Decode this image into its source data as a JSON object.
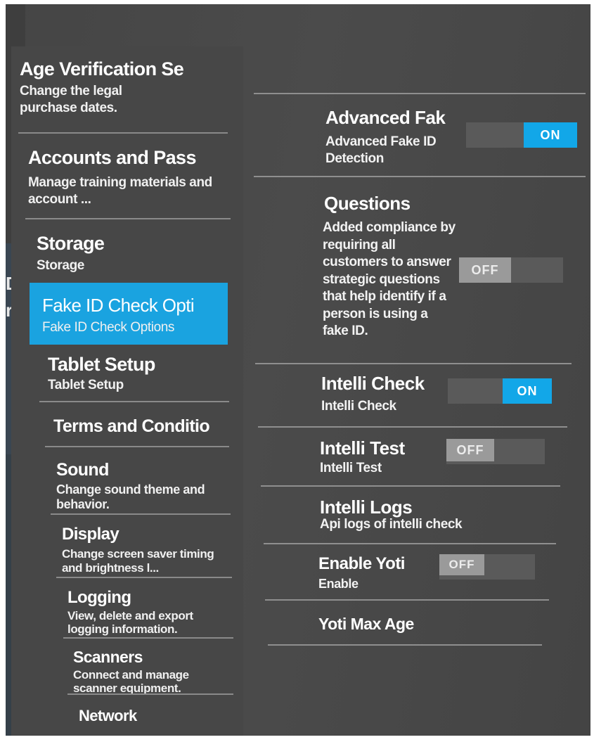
{
  "background_app": {
    "letters": [
      "D",
      "re"
    ]
  },
  "sidebar": {
    "active_color": "#1aa3e0",
    "items": [
      {
        "title": "Age Verification Se",
        "subtitle": "Change the legal purchase dates."
      },
      {
        "title": "Accounts and Pass",
        "subtitle": "Manage training materials and account ..."
      },
      {
        "title": "Storage",
        "subtitle": "Storage"
      },
      {
        "title": "Fake ID Check Opti",
        "subtitle": "Fake ID Check Options",
        "active": true
      },
      {
        "title": "Tablet Setup",
        "subtitle": "Tablet Setup"
      },
      {
        "title": "Terms and Conditio",
        "subtitle": ""
      },
      {
        "title": "Sound",
        "subtitle": "Change sound theme and behavior."
      },
      {
        "title": "Display",
        "subtitle": "Change screen saver timing and brightness l..."
      },
      {
        "title": "Logging",
        "subtitle": "View, delete and export logging information."
      },
      {
        "title": "Scanners",
        "subtitle": "Connect and manage scanner equipment."
      },
      {
        "title": "Network",
        "subtitle": ""
      }
    ]
  },
  "settings": {
    "on_color": "#12a7e8",
    "off_color": "#9a9a9a",
    "items": [
      {
        "title": "Advanced Fak",
        "subtitle": "Advanced Fake ID Detection",
        "toggle": "ON"
      },
      {
        "title": "Questions",
        "subtitle": "Added compliance by requiring all customers to answer strategic questions that help identify if a person is using a fake ID.",
        "toggle": "OFF"
      },
      {
        "title": "Intelli Check",
        "subtitle": "Intelli Check",
        "toggle": "ON"
      },
      {
        "title": "Intelli Test",
        "subtitle": "Intelli Test",
        "toggle": "OFF"
      },
      {
        "title": "Intelli Logs",
        "subtitle": "Api logs of intelli check"
      },
      {
        "title": "Enable Yoti",
        "subtitle": "Enable",
        "toggle": "OFF"
      },
      {
        "title": "Yoti Max Age",
        "subtitle": ""
      }
    ]
  }
}
